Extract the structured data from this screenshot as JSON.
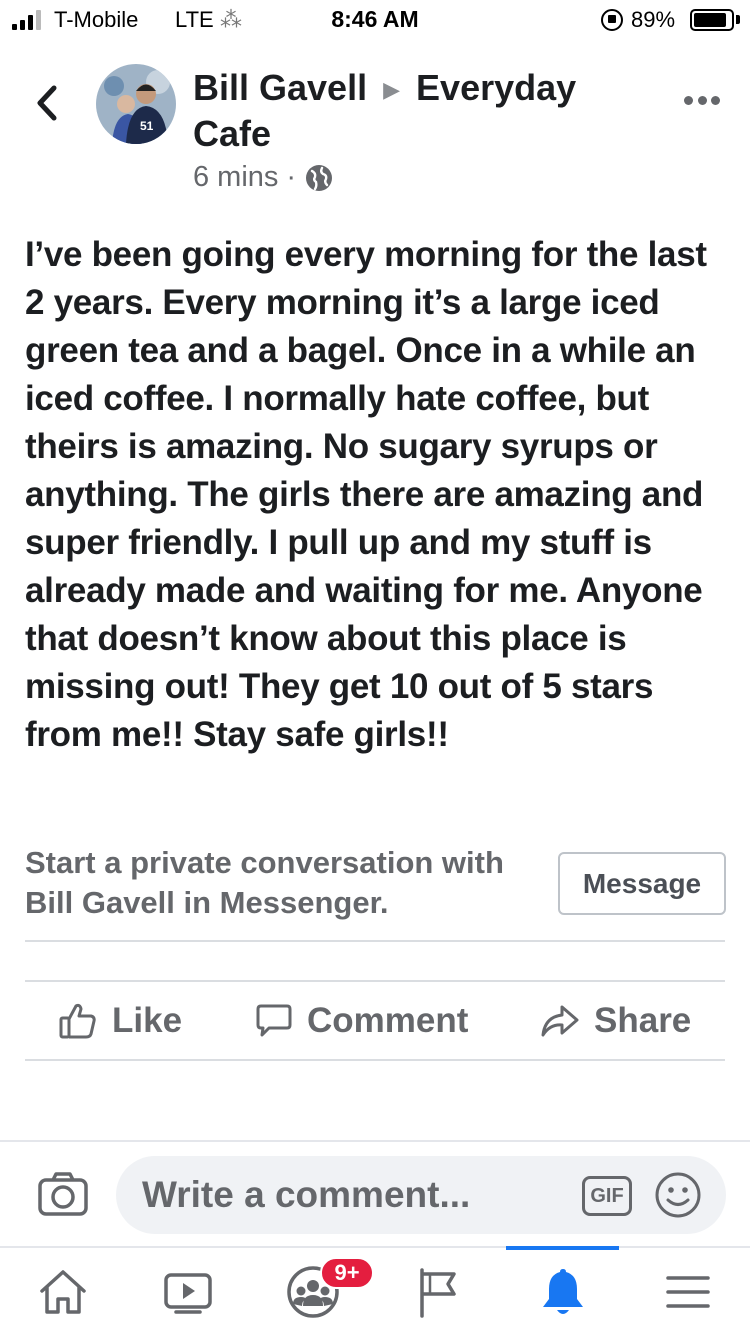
{
  "status_bar": {
    "carrier": "T-Mobile",
    "network": "LTE",
    "loading_glyph": "⁂",
    "time": "8:46 AM",
    "battery_percent": "89%",
    "battery_level": 0.89
  },
  "post": {
    "author": "Bill Gavell",
    "target": "Everyday Cafe",
    "timestamp": "6 mins",
    "separator": "·",
    "audience_icon": "globe-icon",
    "body": "I’ve been going every morning for the last 2 years. Every morning it’s a large iced green tea and a bagel. Once in a while an iced coffee. I normally hate coffee, but theirs is amazing. No sugary syrups or anything. The girls there are amazing and super friendly. I pull up and my stuff is already made and waiting for me. Anyone that doesn’t know about this place is missing out! They get 10 out of 5 stars from me!! Stay safe girls!!"
  },
  "messenger": {
    "prompt": "Start a private conversation with Bill Gavell in Messenger.",
    "button_label": "Message"
  },
  "actions": {
    "like": "Like",
    "comment": "Comment",
    "share": "Share"
  },
  "composer": {
    "placeholder": "Write a comment...",
    "gif_label": "GIF"
  },
  "bottom_nav": {
    "items": [
      "home-icon",
      "watch-icon",
      "groups-icon",
      "pages-icon",
      "notifications-icon",
      "menu-icon"
    ],
    "active": "notifications-icon",
    "groups_badge": "9+"
  },
  "colors": {
    "accent": "#1877f2",
    "badge": "#e41e3f",
    "secondary_text": "#65676b",
    "primary_text": "#1c1e21"
  }
}
